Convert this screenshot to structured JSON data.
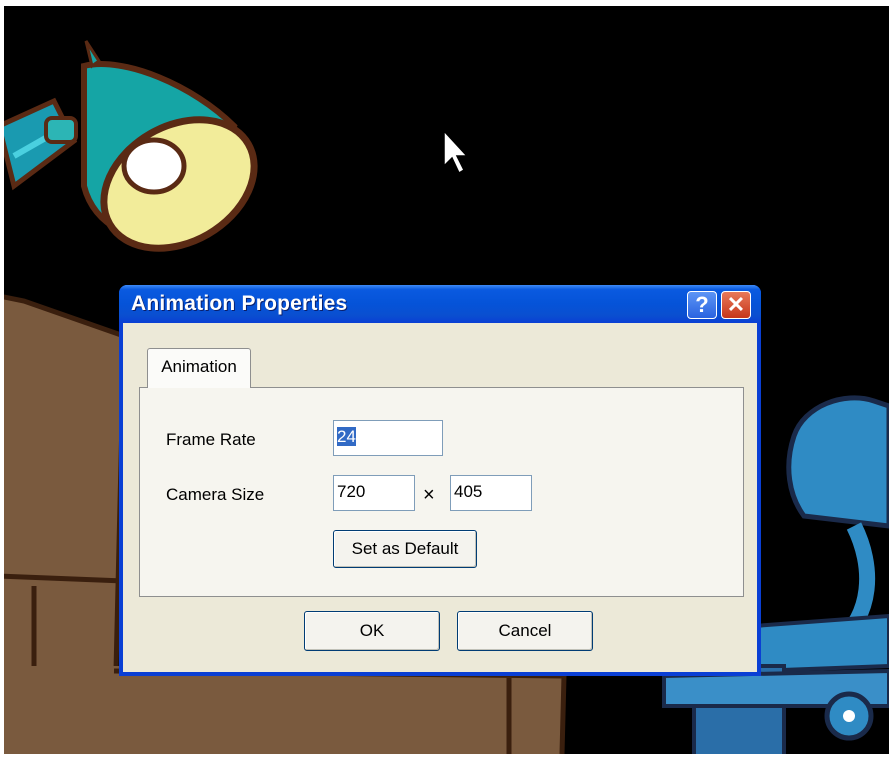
{
  "dialog": {
    "title": "Animation Properties",
    "help_button": "?",
    "close_button": "✕",
    "tab_label": "Animation",
    "frame_rate_label": "Frame Rate",
    "frame_rate_value": "24",
    "camera_size_label": "Camera Size",
    "camera_width": "720",
    "size_separator": "×",
    "camera_height": "405",
    "set_default_button": "Set as Default",
    "ok_button": "OK",
    "cancel_button": "Cancel"
  },
  "colors": {
    "titlebar": "#0a3fd4",
    "dialog_bg": "#ece9d8",
    "scene_bg": "#000000",
    "lamp": "#1aa6a6",
    "desk": "#7a5a3e",
    "chair": "#2f8bc4"
  }
}
